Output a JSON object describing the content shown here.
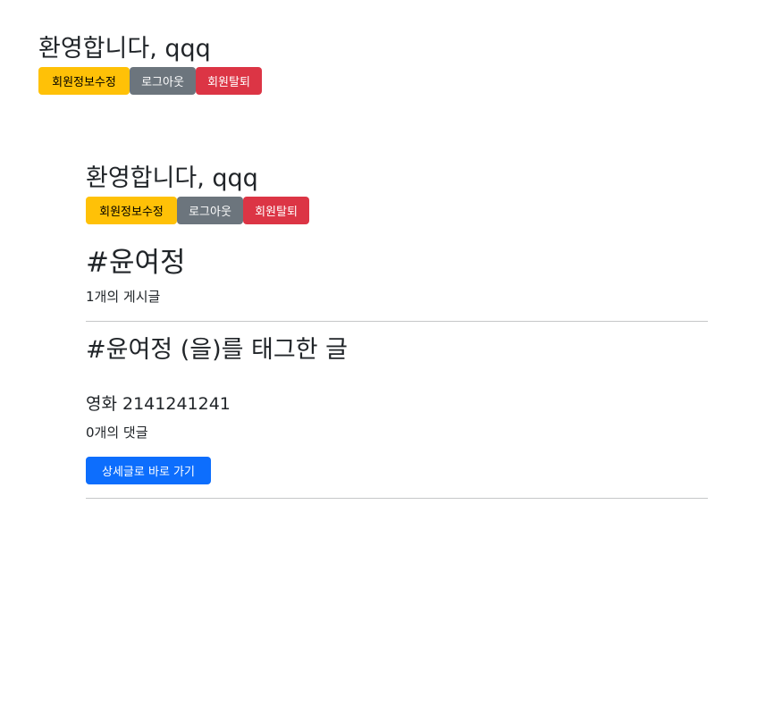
{
  "header": {
    "welcome": "환영합니다, qqq",
    "edit_label": "회원정보수정",
    "logout_label": "로그아웃",
    "withdraw_label": "회원탈퇴"
  },
  "inner_header": {
    "welcome": "환영합니다, qqq",
    "edit_label": "회원정보수정",
    "logout_label": "로그아웃",
    "withdraw_label": "회원탈퇴"
  },
  "hashtag": {
    "title": "#윤여정",
    "post_count": "1개의 게시글"
  },
  "section": {
    "title": "#윤여정 (을)를 태그한 글"
  },
  "posts": [
    {
      "title": "영화 2141241241",
      "comments": "0개의 댓글",
      "detail_label": "상세글로 바로 가기"
    }
  ],
  "colors": {
    "warning": "#ffc107",
    "secondary": "#6c757d",
    "danger": "#dc3545",
    "primary": "#0d6efd"
  }
}
